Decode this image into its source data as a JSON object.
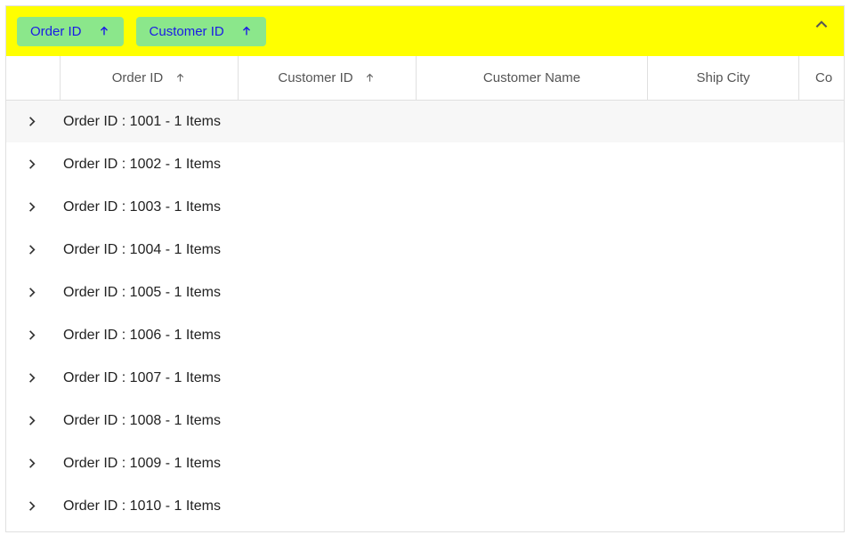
{
  "group_area": {
    "chips": [
      {
        "label": "Order ID",
        "sort": "asc"
      },
      {
        "label": "Customer ID",
        "sort": "asc"
      }
    ]
  },
  "columns": {
    "order_id": "Order ID",
    "customer_id": "Customer ID",
    "customer_name": "Customer Name",
    "ship_city": "Ship City",
    "country_partial": "Co"
  },
  "groups": [
    {
      "caption": "Order ID : 1001 - 1 Items",
      "active": true
    },
    {
      "caption": "Order ID : 1002 - 1 Items",
      "active": false
    },
    {
      "caption": "Order ID : 1003 - 1 Items",
      "active": false
    },
    {
      "caption": "Order ID : 1004 - 1 Items",
      "active": false
    },
    {
      "caption": "Order ID : 1005 - 1 Items",
      "active": false
    },
    {
      "caption": "Order ID : 1006 - 1 Items",
      "active": false
    },
    {
      "caption": "Order ID : 1007 - 1 Items",
      "active": false
    },
    {
      "caption": "Order ID : 1008 - 1 Items",
      "active": false
    },
    {
      "caption": "Order ID : 1009 - 1 Items",
      "active": false
    },
    {
      "caption": "Order ID : 1010 - 1 Items",
      "active": false
    }
  ]
}
